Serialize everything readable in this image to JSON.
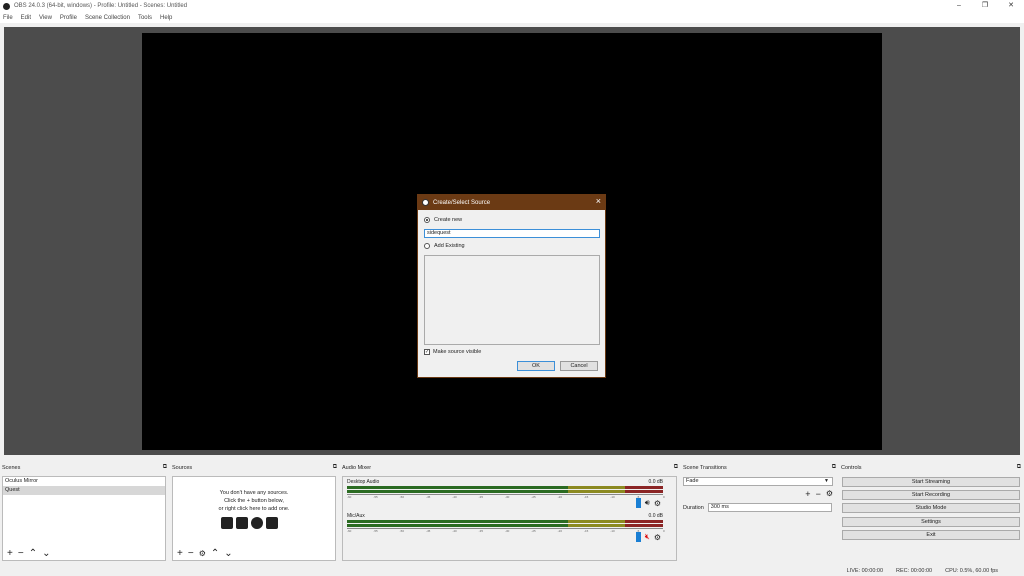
{
  "window": {
    "title": "OBS 24.0.3 (64-bit, windows) - Profile: Untitled - Scenes: Untitled"
  },
  "menu": [
    "File",
    "Edit",
    "View",
    "Profile",
    "Scene Collection",
    "Tools",
    "Help"
  ],
  "dialog": {
    "title": "Create/Select Source",
    "create_new": "Create new",
    "name_value": "sidequest",
    "add_existing": "Add Existing",
    "make_visible": "Make source visible",
    "ok": "OK",
    "cancel": "Cancel"
  },
  "scenes": {
    "title": "Scenes",
    "items": [
      "Oculus Mirror",
      "Quest"
    ],
    "selected_index": 1
  },
  "sources": {
    "title": "Sources",
    "empty_line1": "You don't have any sources.",
    "empty_line2": "Click the + button below,",
    "empty_line3": "or right click here to add one."
  },
  "mixer": {
    "title": "Audio Mixer",
    "channels": [
      {
        "name": "Desktop Audio",
        "db": "0.0 dB",
        "muted": false
      },
      {
        "name": "Mic/Aux",
        "db": "0.0 dB",
        "muted": true
      }
    ],
    "ticks": [
      "-60",
      "-55",
      "-50",
      "-45",
      "-40",
      "-35",
      "-30",
      "-25",
      "-20",
      "-15",
      "-10",
      "-5",
      "0"
    ]
  },
  "transitions": {
    "title": "Scene Transitions",
    "selected": "Fade",
    "duration_label": "Duration",
    "duration_value": "300 ms"
  },
  "controls": {
    "title": "Controls",
    "buttons": [
      "Start Streaming",
      "Start Recording",
      "Studio Mode",
      "Settings",
      "Exit"
    ]
  },
  "status": {
    "live": "LIVE: 00:00:00",
    "rec": "REC: 00:00:00",
    "cpu": "CPU: 0.5%, 60.00 fps"
  }
}
